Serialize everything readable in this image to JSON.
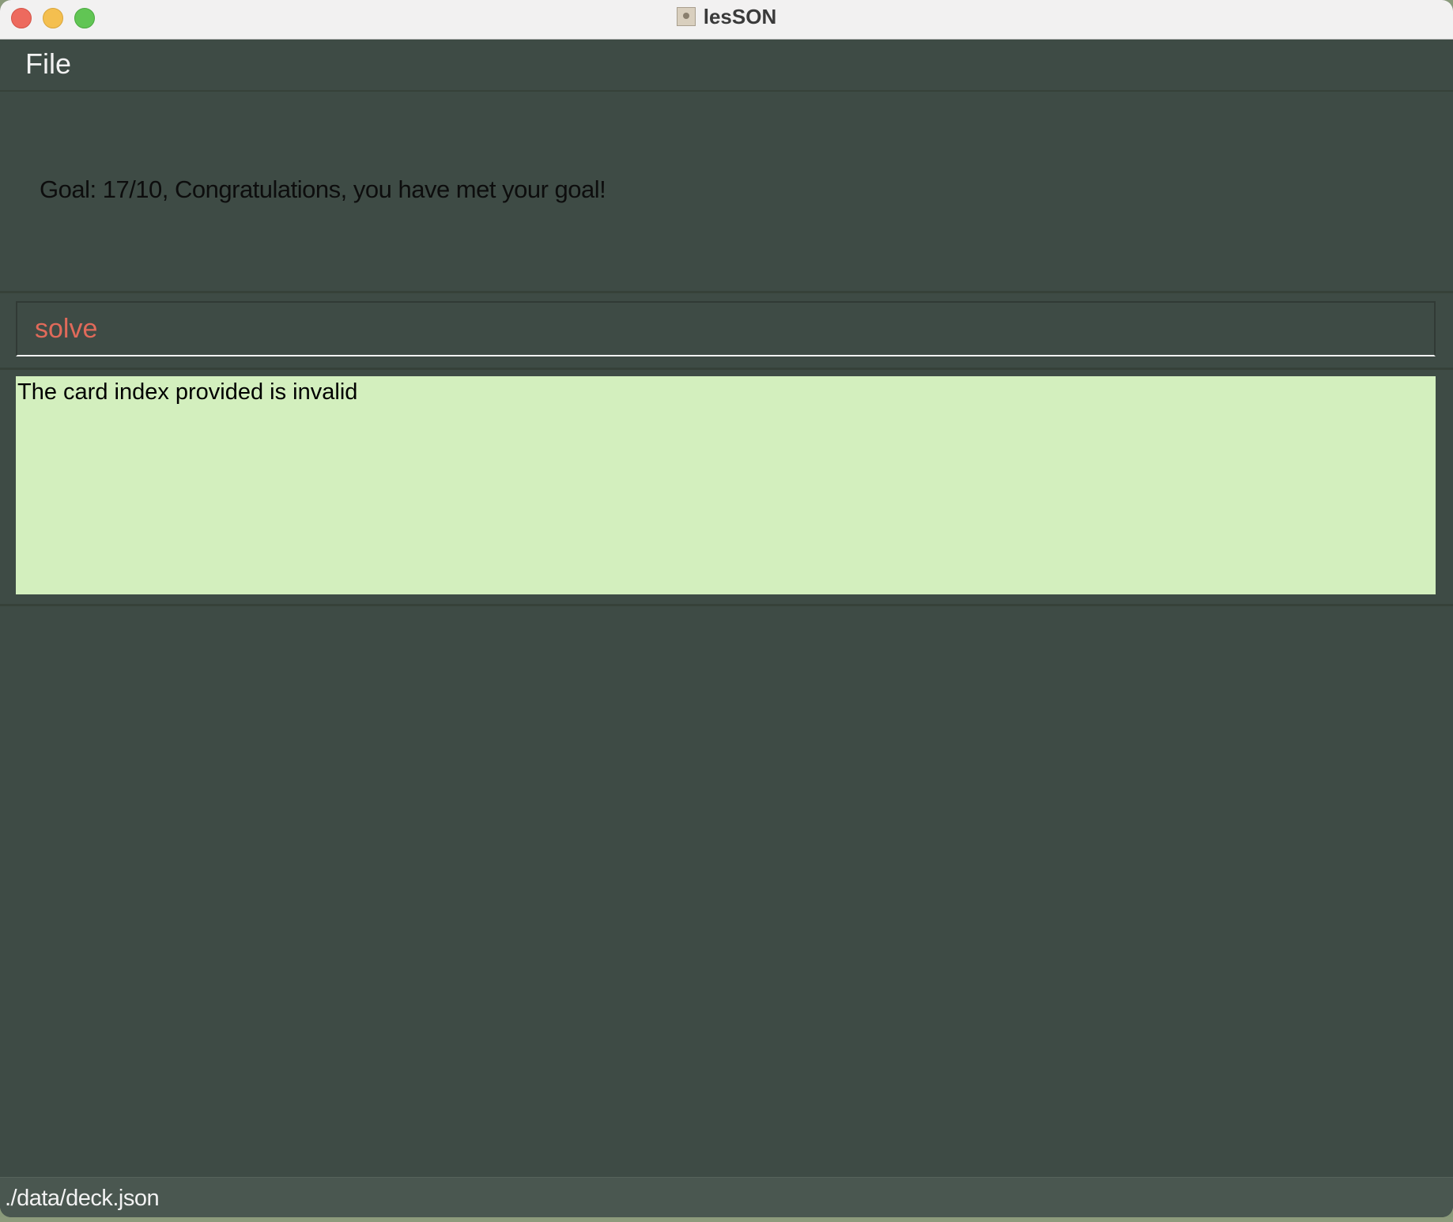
{
  "window": {
    "title": "lesSON",
    "app_icon": "app-document-icon"
  },
  "menubar": {
    "file_label": "File"
  },
  "goal": {
    "text": "Goal: 17/10, Congratulations, you have met your goal!"
  },
  "command": {
    "value": "solve",
    "text_color": "#e06a5a"
  },
  "result": {
    "text": "The card index provided is invalid",
    "background": "#d3efbe"
  },
  "statusbar": {
    "path": "./data/deck.json"
  },
  "colors": {
    "window_bg": "#3e4b45",
    "close": "#ed6a5e",
    "minimize": "#f4bf4f",
    "maximize": "#61c554"
  }
}
